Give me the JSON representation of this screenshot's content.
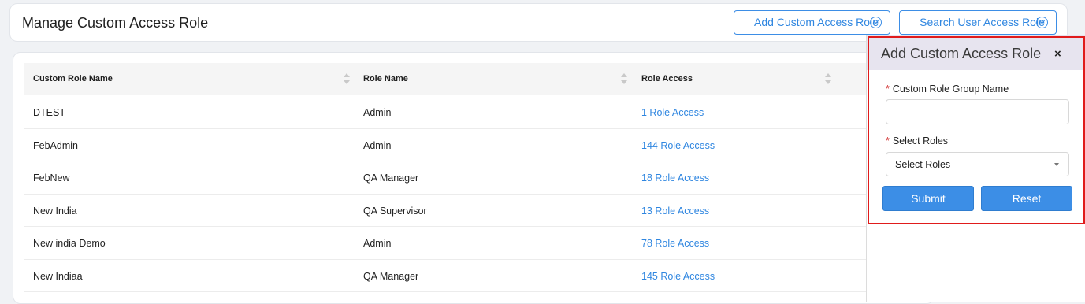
{
  "header": {
    "title": "Manage Custom Access Role",
    "add_button": "Add Custom Access Role",
    "search_button": "Search User Access Role"
  },
  "table": {
    "columns": [
      "Custom Role Name",
      "Role Name",
      "Role Access"
    ],
    "rows": [
      {
        "custom_role_name": "DTEST",
        "role_name": "Admin",
        "role_access": "1 Role Access"
      },
      {
        "custom_role_name": "FebAdmin",
        "role_name": "Admin",
        "role_access": "144 Role Access"
      },
      {
        "custom_role_name": "FebNew",
        "role_name": "QA Manager",
        "role_access": "18 Role Access"
      },
      {
        "custom_role_name": "New India",
        "role_name": "QA Supervisor",
        "role_access": "13 Role Access"
      },
      {
        "custom_role_name": "New india Demo",
        "role_name": "Admin",
        "role_access": "78 Role Access"
      },
      {
        "custom_role_name": "New Indiaa",
        "role_name": "QA Manager",
        "role_access": "145 Role Access"
      }
    ]
  },
  "panel": {
    "title": "Add Custom Access Role",
    "close_glyph": "×",
    "required_mark": "*",
    "group_name_label": "Custom Role Group Name",
    "group_name_value": "",
    "select_label": "Select Roles",
    "select_value": "Select Roles",
    "submit_label": "Submit",
    "reset_label": "Reset"
  },
  "colors": {
    "accent": "#3c8ee6",
    "link": "#2f86e0",
    "highlight": "#e01b1b",
    "panel_header": "#e7e4ef"
  }
}
